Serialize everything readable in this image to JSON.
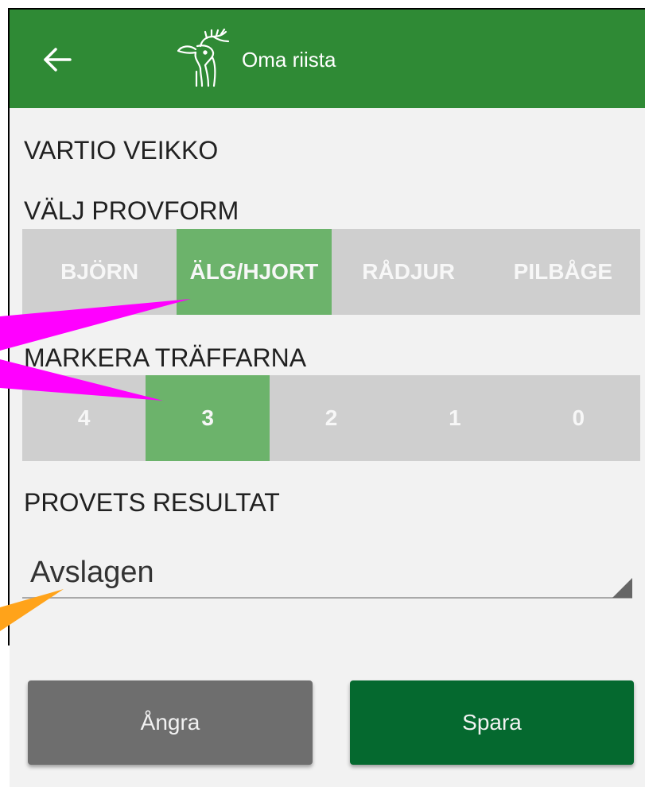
{
  "app_bar": {
    "title": "Oma riista",
    "back_icon": "arrow-left-icon",
    "logo_icon": "moose-logo-icon"
  },
  "shooter_name": "VARTIO VEIKKO",
  "test_type": {
    "label": "VÄLJ PROVFORM",
    "options": [
      "BJÖRN",
      "ÄLG/HJORT",
      "RÅDJUR",
      "PILBÅGE"
    ],
    "selected": "ÄLG/HJORT"
  },
  "hits": {
    "label": "MARKERA TRÄFFARNA",
    "options": [
      "4",
      "3",
      "2",
      "1",
      "0"
    ],
    "selected": "3"
  },
  "result": {
    "label": "PROVETS RESULTAT",
    "value": "Avslagen",
    "dropdown_icon": "dropdown-triangle-icon"
  },
  "actions": {
    "cancel_label": "Ångra",
    "save_label": "Spara"
  },
  "colors": {
    "app_bar": "#2f8a35",
    "segment_default": "#cfcfcf",
    "segment_selected": "#6cb36b",
    "cancel_button": "#6e6e6e",
    "save_button": "#05692f",
    "annotation_magenta": "#ff00ff",
    "annotation_orange": "#ffa31a"
  }
}
